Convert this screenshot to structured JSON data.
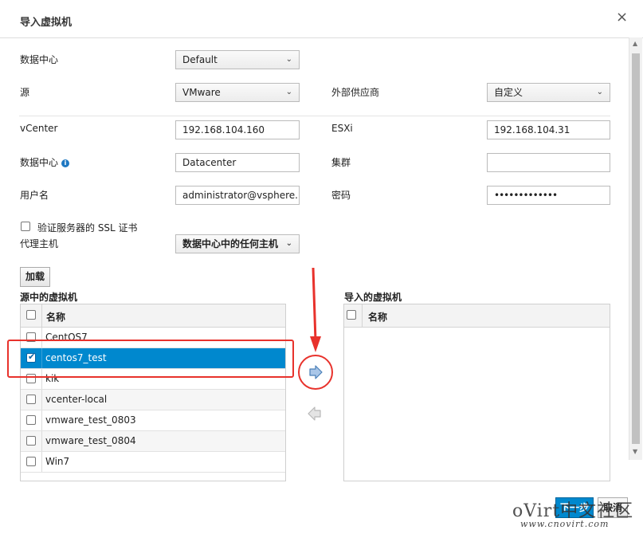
{
  "dialog": {
    "title": "导入虚拟机",
    "close_glyph": "×"
  },
  "form": {
    "datacenter_label": "数据中心",
    "datacenter_value": "Default",
    "source_label": "源",
    "source_value": "VMware",
    "provider_label": "外部供应商",
    "provider_value": "自定义",
    "vcenter_label": "vCenter",
    "vcenter_value": "192.168.104.160",
    "esxi_label": "ESXi",
    "esxi_value": "192.168.104.31",
    "dc2_label": "数据中心",
    "dc2_value": "Datacenter",
    "cluster_label": "集群",
    "cluster_value": "",
    "username_label": "用户名",
    "username_value": "administrator@vsphere.lc",
    "password_label": "密码",
    "password_value": "•••••••••••••",
    "ssl_label": "验证服务器的 SSL 证书",
    "proxy_label": "代理主机",
    "proxy_value": "数据中心中的任何主机",
    "load_button": "加载",
    "info_glyph": "i",
    "caret_glyph": "⌄"
  },
  "source_vms": {
    "title": "源中的虚拟机",
    "column_name": "名称",
    "rows": [
      {
        "name": "CentOS7",
        "checked": false,
        "selected": false
      },
      {
        "name": "centos7_test",
        "checked": true,
        "selected": true
      },
      {
        "name": "kik",
        "checked": false,
        "selected": false
      },
      {
        "name": "vcenter-local",
        "checked": false,
        "selected": false
      },
      {
        "name": "vmware_test_0803",
        "checked": false,
        "selected": false
      },
      {
        "name": "vmware_test_0804",
        "checked": false,
        "selected": false
      },
      {
        "name": "Win7",
        "checked": false,
        "selected": false
      }
    ]
  },
  "target_vms": {
    "title": "导入的虚拟机",
    "column_name": "名称"
  },
  "footer": {
    "next_label": "下一步",
    "cancel_label": "取消"
  },
  "watermark": {
    "text": "oVirt中文社区",
    "url": "www.cnovirt.com"
  },
  "colors": {
    "selected_row": "#0088ce",
    "annotation": "#e8322c",
    "primary_button": "#0088ce"
  }
}
